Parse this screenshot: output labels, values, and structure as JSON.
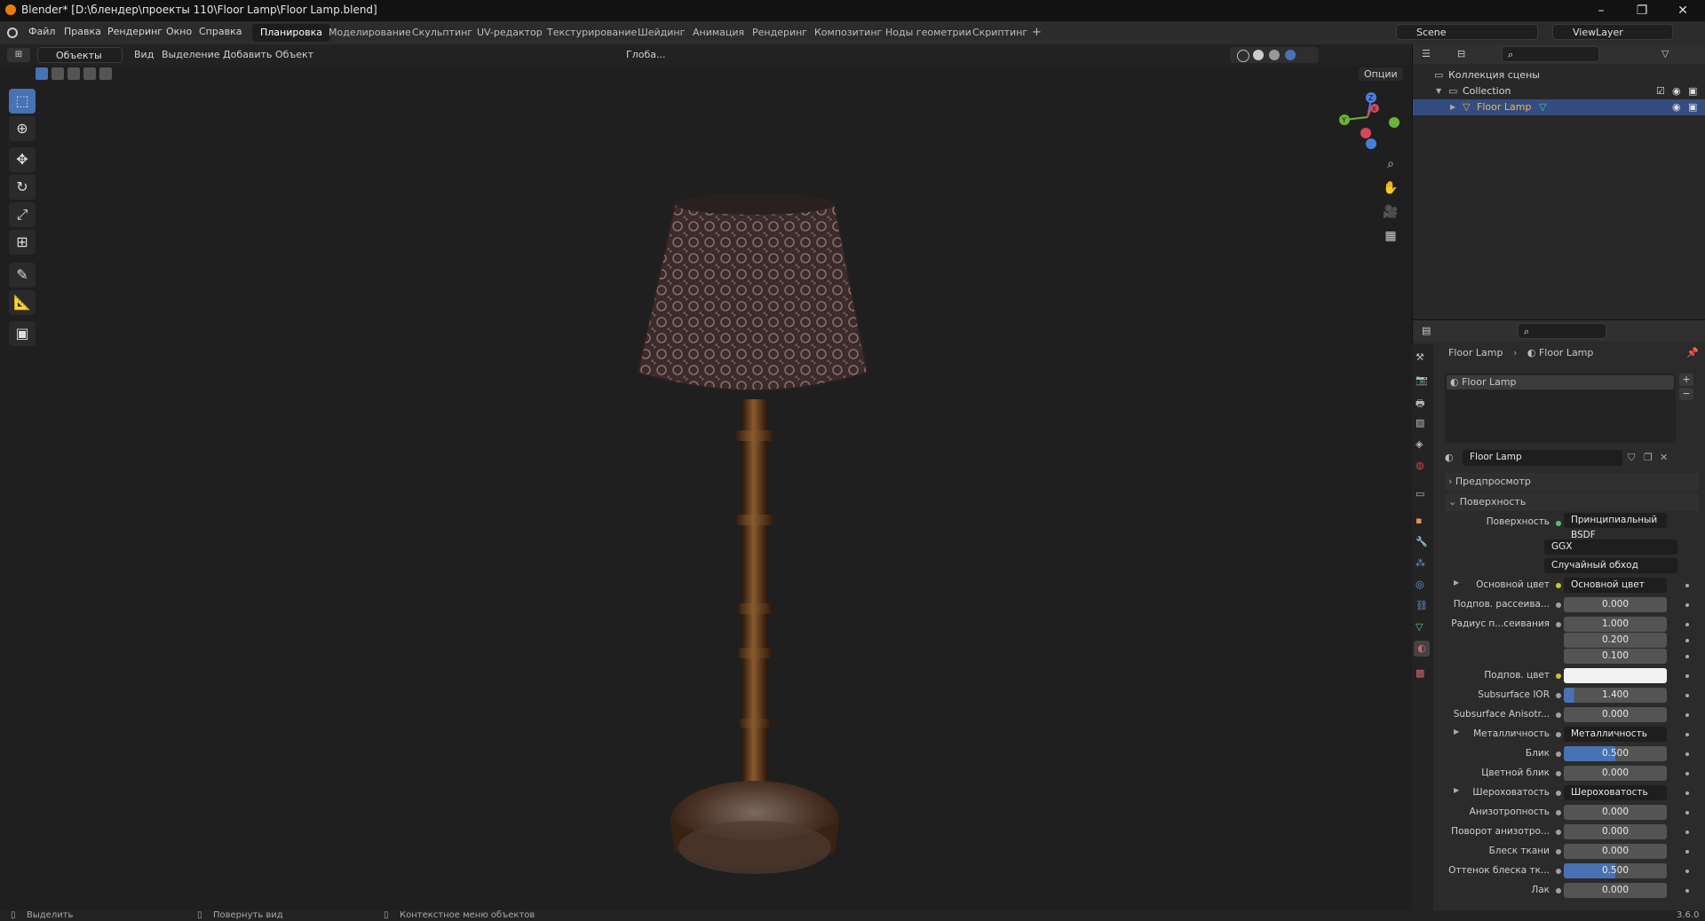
{
  "window": {
    "title": "Blender* [D:\\блендер\\проекты 110\\Floor Lamp\\Floor Lamp.blend]",
    "controls": [
      "–",
      "❐",
      "✕"
    ]
  },
  "menu": [
    "Файл",
    "Правка",
    "Рендеринг",
    "Окно",
    "Справка"
  ],
  "workspaces": [
    "Планировка",
    "Моделирование",
    "Скульптинг",
    "UV-редактор",
    "Текстурирование",
    "Шейдинг",
    "Анимация",
    "Рендеринг",
    "Композитинг",
    "Ноды геометрии",
    "Скриптинг",
    "+"
  ],
  "scene": {
    "label": "Scene"
  },
  "viewlayer": {
    "label": "ViewLayer"
  },
  "viewport": {
    "mode": "Объекты",
    "menus": [
      "Вид",
      "Выделение",
      "Добавить",
      "Объект"
    ],
    "orientation": "Глоба...",
    "options_label": "Опции",
    "gizmo_axes": [
      "Z",
      "Y",
      "X"
    ]
  },
  "outliner": {
    "rows": [
      {
        "label": "Коллекция сцены"
      },
      {
        "label": "Collection"
      },
      {
        "label": "Floor Lamp"
      }
    ]
  },
  "properties": {
    "breadcrumb": [
      "Floor Lamp",
      "Floor Lamp"
    ],
    "slot_item": "Floor Lamp",
    "material_name": "Floor Lamp",
    "panels": {
      "preview": "Предпросмотр",
      "surface": "Поверхность"
    },
    "surface_label": "Поверхность",
    "surface_value": "Принципиальный BSDF",
    "distribution": "GGX",
    "subsurface_method": "Случайный обход",
    "rows": [
      {
        "label": "Основной цвет",
        "value": "Основной цвет",
        "kind": "link",
        "dot": "#c7c729"
      },
      {
        "label": "Подпов. рассеива...",
        "value": "0.000",
        "kind": "num"
      },
      {
        "label": "Радиус п...сеивания",
        "value": "1.000",
        "kind": "num"
      },
      {
        "label": "",
        "value": "0.200",
        "kind": "num"
      },
      {
        "label": "",
        "value": "0.100",
        "kind": "num"
      },
      {
        "label": "Подпов. цвет",
        "value": "",
        "kind": "color",
        "dot": "#c7c729"
      },
      {
        "label": "Subsurface IOR",
        "value": "1.400",
        "kind": "blue",
        "fill": "10%"
      },
      {
        "label": "Subsurface Anisotr...",
        "value": "0.000",
        "kind": "num"
      },
      {
        "label": "Металличность",
        "value": "Металличность",
        "kind": "link",
        "dot": "#a0a0a0"
      },
      {
        "label": "Блик",
        "value": "0.500",
        "kind": "blue",
        "fill": "50%"
      },
      {
        "label": "Цветной блик",
        "value": "0.000",
        "kind": "num"
      },
      {
        "label": "Шероховатость",
        "value": "Шероховатость",
        "kind": "link",
        "dot": "#a0a0a0"
      },
      {
        "label": "Анизотропность",
        "value": "0.000",
        "kind": "num"
      },
      {
        "label": "Поворот анизотро...",
        "value": "0.000",
        "kind": "num"
      },
      {
        "label": "Блеск ткани",
        "value": "0.000",
        "kind": "num"
      },
      {
        "label": "Оттенок блеска тк...",
        "value": "0.500",
        "kind": "blue",
        "fill": "50%"
      },
      {
        "label": "Лак",
        "value": "0.000",
        "kind": "num"
      }
    ]
  },
  "status": {
    "items": [
      "Выделить",
      "Повернуть вид",
      "Контекстное меню объектов"
    ],
    "version": "3.6.0"
  },
  "colors": {
    "accent": "#4772b3",
    "selection": "#334d80",
    "background": "#1d1d1d"
  }
}
